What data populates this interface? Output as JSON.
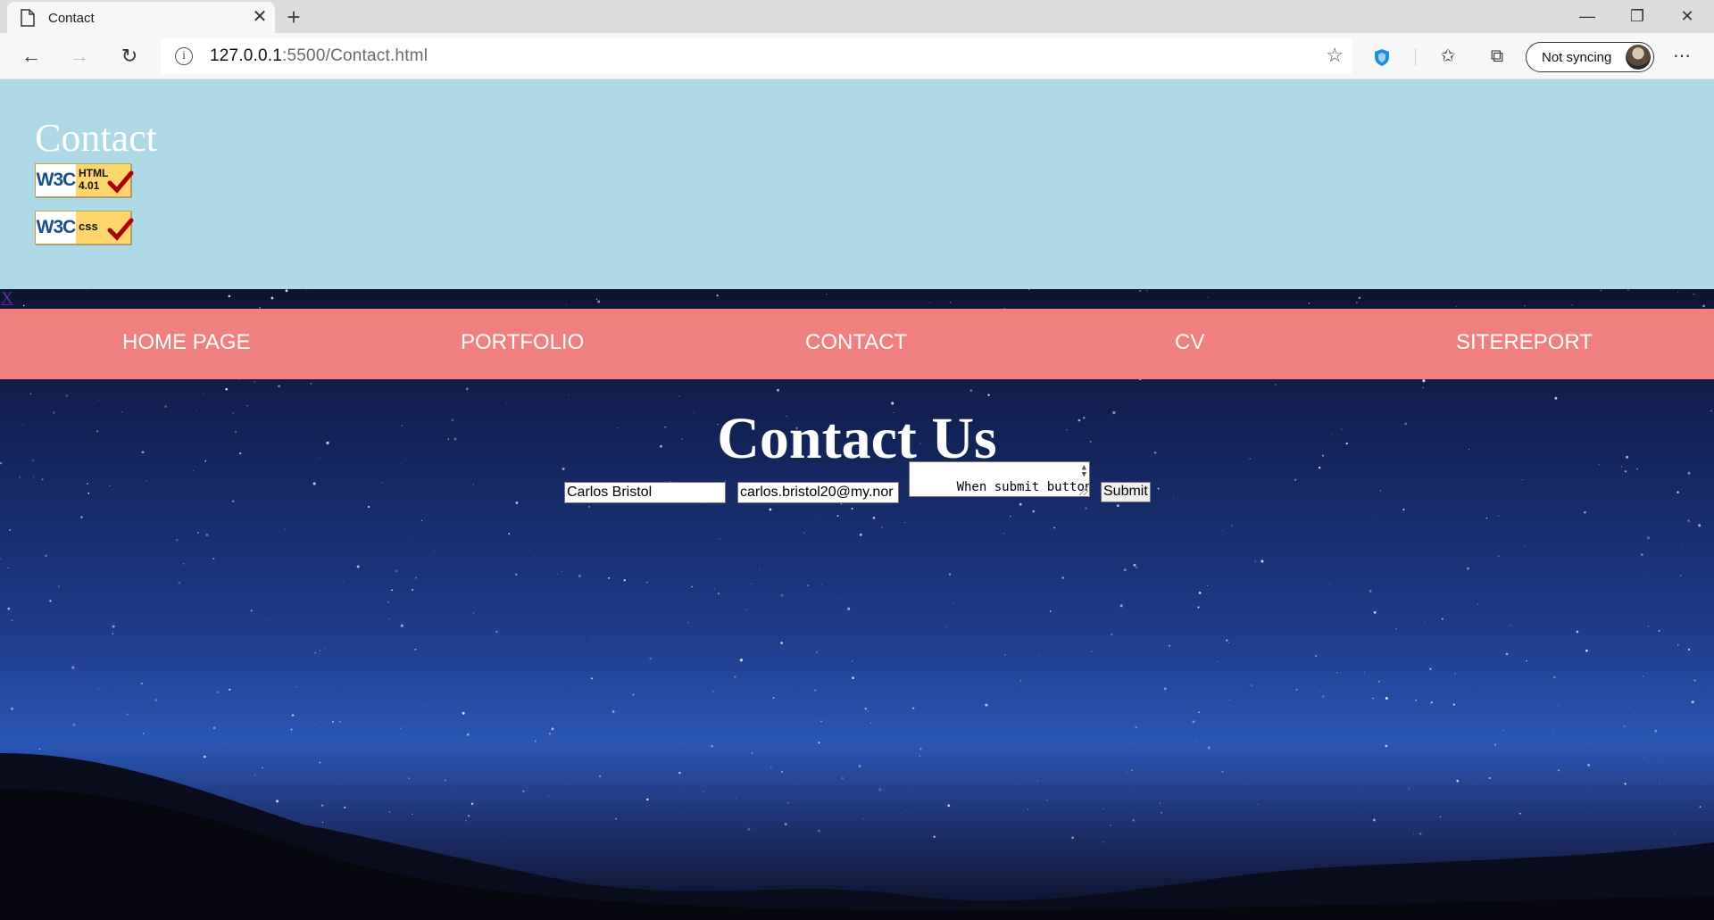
{
  "browser": {
    "tab_title": "Contact",
    "address": {
      "host": "127.0.0.1",
      "rest": ":5500/Contact.html"
    },
    "sync_label": "Not syncing",
    "icons": [
      "page-icon",
      "close-icon",
      "new-tab-icon",
      "minimize-icon",
      "restore-icon",
      "window-close-icon",
      "back-icon",
      "forward-icon",
      "refresh-icon",
      "info-icon",
      "favorite-star-icon",
      "shield-icon",
      "favorites-icon",
      "collections-icon",
      "more-icon"
    ]
  },
  "header": {
    "title": "Contact",
    "badge_html": {
      "logo": "W3C",
      "line1": "HTML",
      "line2": "4.01"
    },
    "badge_css": {
      "logo": "W3C",
      "line1": "css"
    }
  },
  "x_link": "X",
  "nav": {
    "items": [
      "HOME PAGE",
      "PORTFOLIO",
      "CONTACT",
      "CV",
      "SITEREPORT"
    ]
  },
  "contact": {
    "heading": "Contact Us",
    "name_value": "Carlos Bristol",
    "email_value": "carlos.bristol20@my.nor",
    "message_value": "When submit button\nis clicked, email is",
    "submit_label": "Submit"
  },
  "colors": {
    "header_bg": "#add8e6",
    "nav_bg": "#f08080",
    "text": "#ffffff"
  }
}
